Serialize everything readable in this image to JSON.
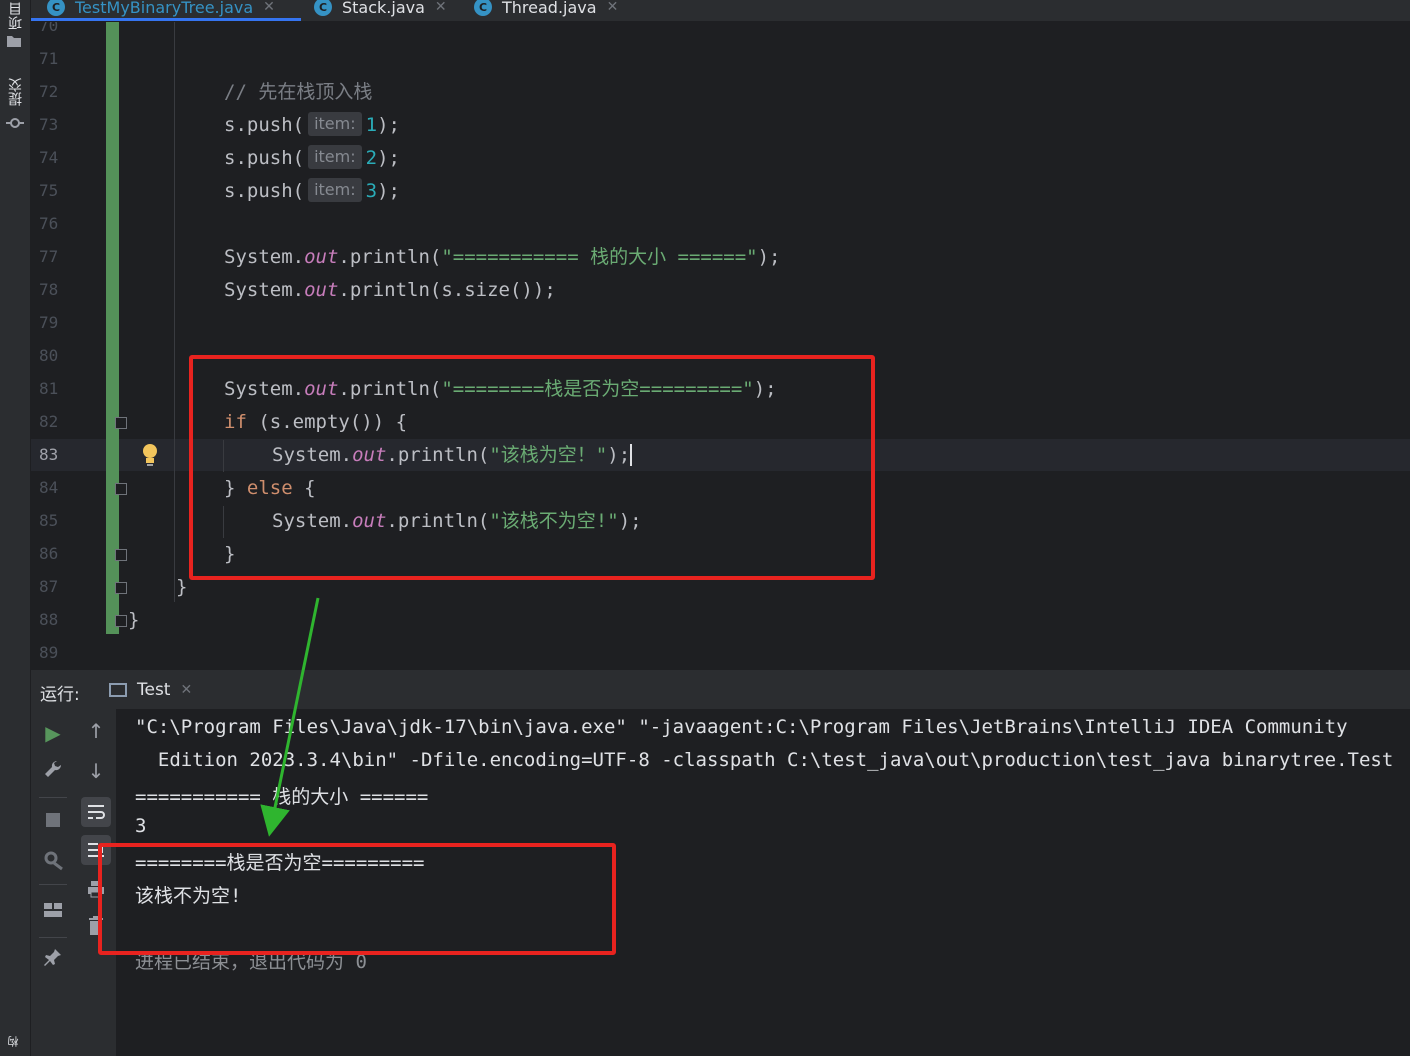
{
  "sidebar": {
    "project_label": "项目",
    "commit_label": "提交",
    "bottom_label": "构"
  },
  "tabs": [
    {
      "label": "TestMyBinaryTree.java",
      "icon": "c",
      "active": true
    },
    {
      "label": "Stack.java",
      "icon": "c",
      "active": false
    },
    {
      "label": "Thread.java",
      "icon": "c",
      "active": false
    }
  ],
  "editor": {
    "line_numbers": [
      "70",
      "71",
      "72",
      "73",
      "74",
      "75",
      "76",
      "77",
      "78",
      "79",
      "80",
      "81",
      "82",
      "83",
      "84",
      "85",
      "86",
      "87",
      "88",
      "89"
    ],
    "current_line": "83",
    "comment_line": "// 先在栈顶入栈",
    "push_lines": [
      {
        "prefix": "s.push(",
        "hint": "item:",
        "arg": "1",
        "suffix": ");"
      },
      {
        "prefix": "s.push(",
        "hint": "item:",
        "arg": "2",
        "suffix": ");"
      },
      {
        "prefix": "s.push(",
        "hint": "item:",
        "arg": "3",
        "suffix": ");"
      }
    ],
    "println_size_header": "\"=========== 栈的大小 ======\"",
    "println_size_arg": "s.size()",
    "println_empty_header": "\"========栈是否为空=========\"",
    "if_cond": "(s.empty())",
    "empty_msg": "\"该栈为空！\"",
    "not_empty_msg": "\"该栈不为空!\"",
    "kw_if": "if",
    "kw_else": "else",
    "system": "System.",
    "out": "out",
    "println": ".println("
  },
  "run_panel": {
    "label": "运行:",
    "tab_label": "Test",
    "output": [
      "\"C:\\Program Files\\Java\\jdk-17\\bin\\java.exe\" \"-javaagent:C:\\Program Files\\JetBrains\\IntelliJ IDEA Community",
      "  Edition 2023.3.4\\bin\" -Dfile.encoding=UTF-8 -classpath C:\\test_java\\out\\production\\test_java binarytree.Test",
      "=========== 栈的大小 ======",
      "3",
      "========栈是否为空=========",
      "该栈不为空!",
      "",
      "进程已结束，退出代码为 0"
    ]
  },
  "colors": {
    "background": "#1e1f22",
    "panel": "#2b2d30",
    "keyword": "#cf8e6d",
    "string": "#6aab73",
    "number": "#2aacb8",
    "field": "#c77dbb",
    "annotation_red": "#e8231f",
    "annotation_green": "#2fb52f",
    "vcs_bar": "#549159",
    "active_tab": "#3592c4"
  }
}
